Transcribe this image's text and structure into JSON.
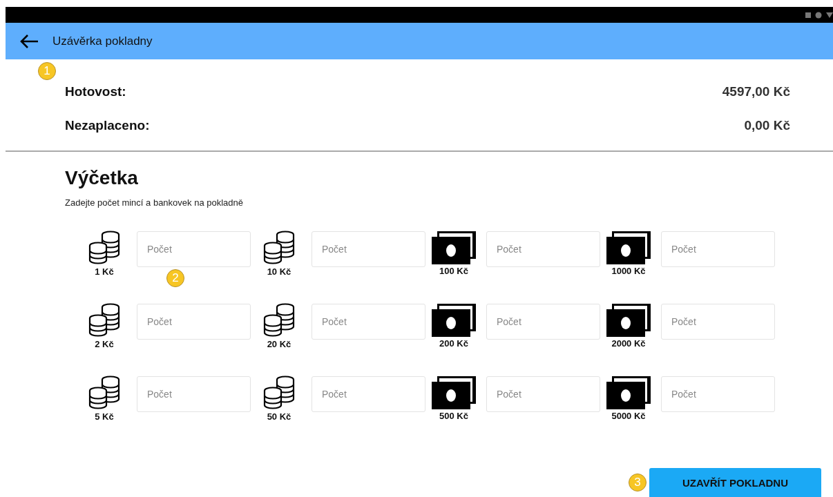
{
  "app_bar": {
    "title": "Uzávěrka pokladny"
  },
  "summary": [
    {
      "label": "Hotovost:",
      "value": "4597,00 Kč"
    },
    {
      "label": "Nezaplaceno:",
      "value": "0,00 Kč"
    }
  ],
  "count_section": {
    "title": "Výčetka",
    "hint": "Zadejte počet mincí a bankovek na pokladně",
    "denominations": [
      {
        "kind": "coin",
        "label": "1 Kč",
        "placeholder": "Počet"
      },
      {
        "kind": "coin",
        "label": "10 Kč",
        "placeholder": "Počet"
      },
      {
        "kind": "note",
        "label": "100 Kč",
        "placeholder": "Počet"
      },
      {
        "kind": "note",
        "label": "1000 Kč",
        "placeholder": "Počet"
      },
      {
        "kind": "coin",
        "label": "2 Kč",
        "placeholder": "Počet"
      },
      {
        "kind": "coin",
        "label": "20 Kč",
        "placeholder": "Počet"
      },
      {
        "kind": "note",
        "label": "200 Kč",
        "placeholder": "Počet"
      },
      {
        "kind": "note",
        "label": "2000 Kč",
        "placeholder": "Počet"
      },
      {
        "kind": "coin",
        "label": "5 Kč",
        "placeholder": "Počet"
      },
      {
        "kind": "coin",
        "label": "50 Kč",
        "placeholder": "Počet"
      },
      {
        "kind": "note",
        "label": "500 Kč",
        "placeholder": "Počet"
      },
      {
        "kind": "note",
        "label": "5000 Kč",
        "placeholder": "Počet"
      }
    ]
  },
  "close_button": {
    "label": "UZAVŘÍT POKLADNU"
  },
  "markers": [
    {
      "number": "1"
    },
    {
      "number": "2"
    },
    {
      "number": "3"
    }
  ]
}
